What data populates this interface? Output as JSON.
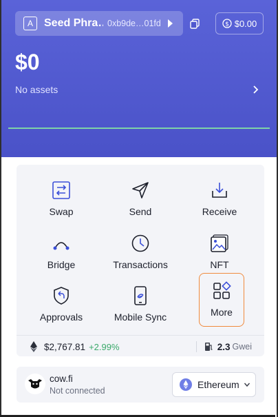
{
  "header": {
    "account_icon_letter": "A",
    "account_name": "Seed Phra…",
    "account_address": "0xb9de…01fd",
    "balance_chip": "$0.00",
    "total_balance": "$0",
    "assets_label": "No assets",
    "accent_color": "#4a52c8"
  },
  "actions": [
    {
      "label": "Swap",
      "icon": "swap-icon"
    },
    {
      "label": "Send",
      "icon": "send-icon"
    },
    {
      "label": "Receive",
      "icon": "receive-icon"
    },
    {
      "label": "Bridge",
      "icon": "bridge-icon"
    },
    {
      "label": "Transactions",
      "icon": "transactions-icon"
    },
    {
      "label": "NFT",
      "icon": "nft-icon"
    },
    {
      "label": "Approvals",
      "icon": "approvals-icon"
    },
    {
      "label": "Mobile Sync",
      "icon": "mobile-sync-icon"
    },
    {
      "label": "More",
      "icon": "more-icon"
    }
  ],
  "market": {
    "eth_price": "$2,767.81",
    "eth_change": "+2.99%",
    "gas_value": "2.3",
    "gas_unit": "Gwei"
  },
  "dapp": {
    "name": "cow.fi",
    "status": "Not connected",
    "chain": "Ethereum"
  }
}
